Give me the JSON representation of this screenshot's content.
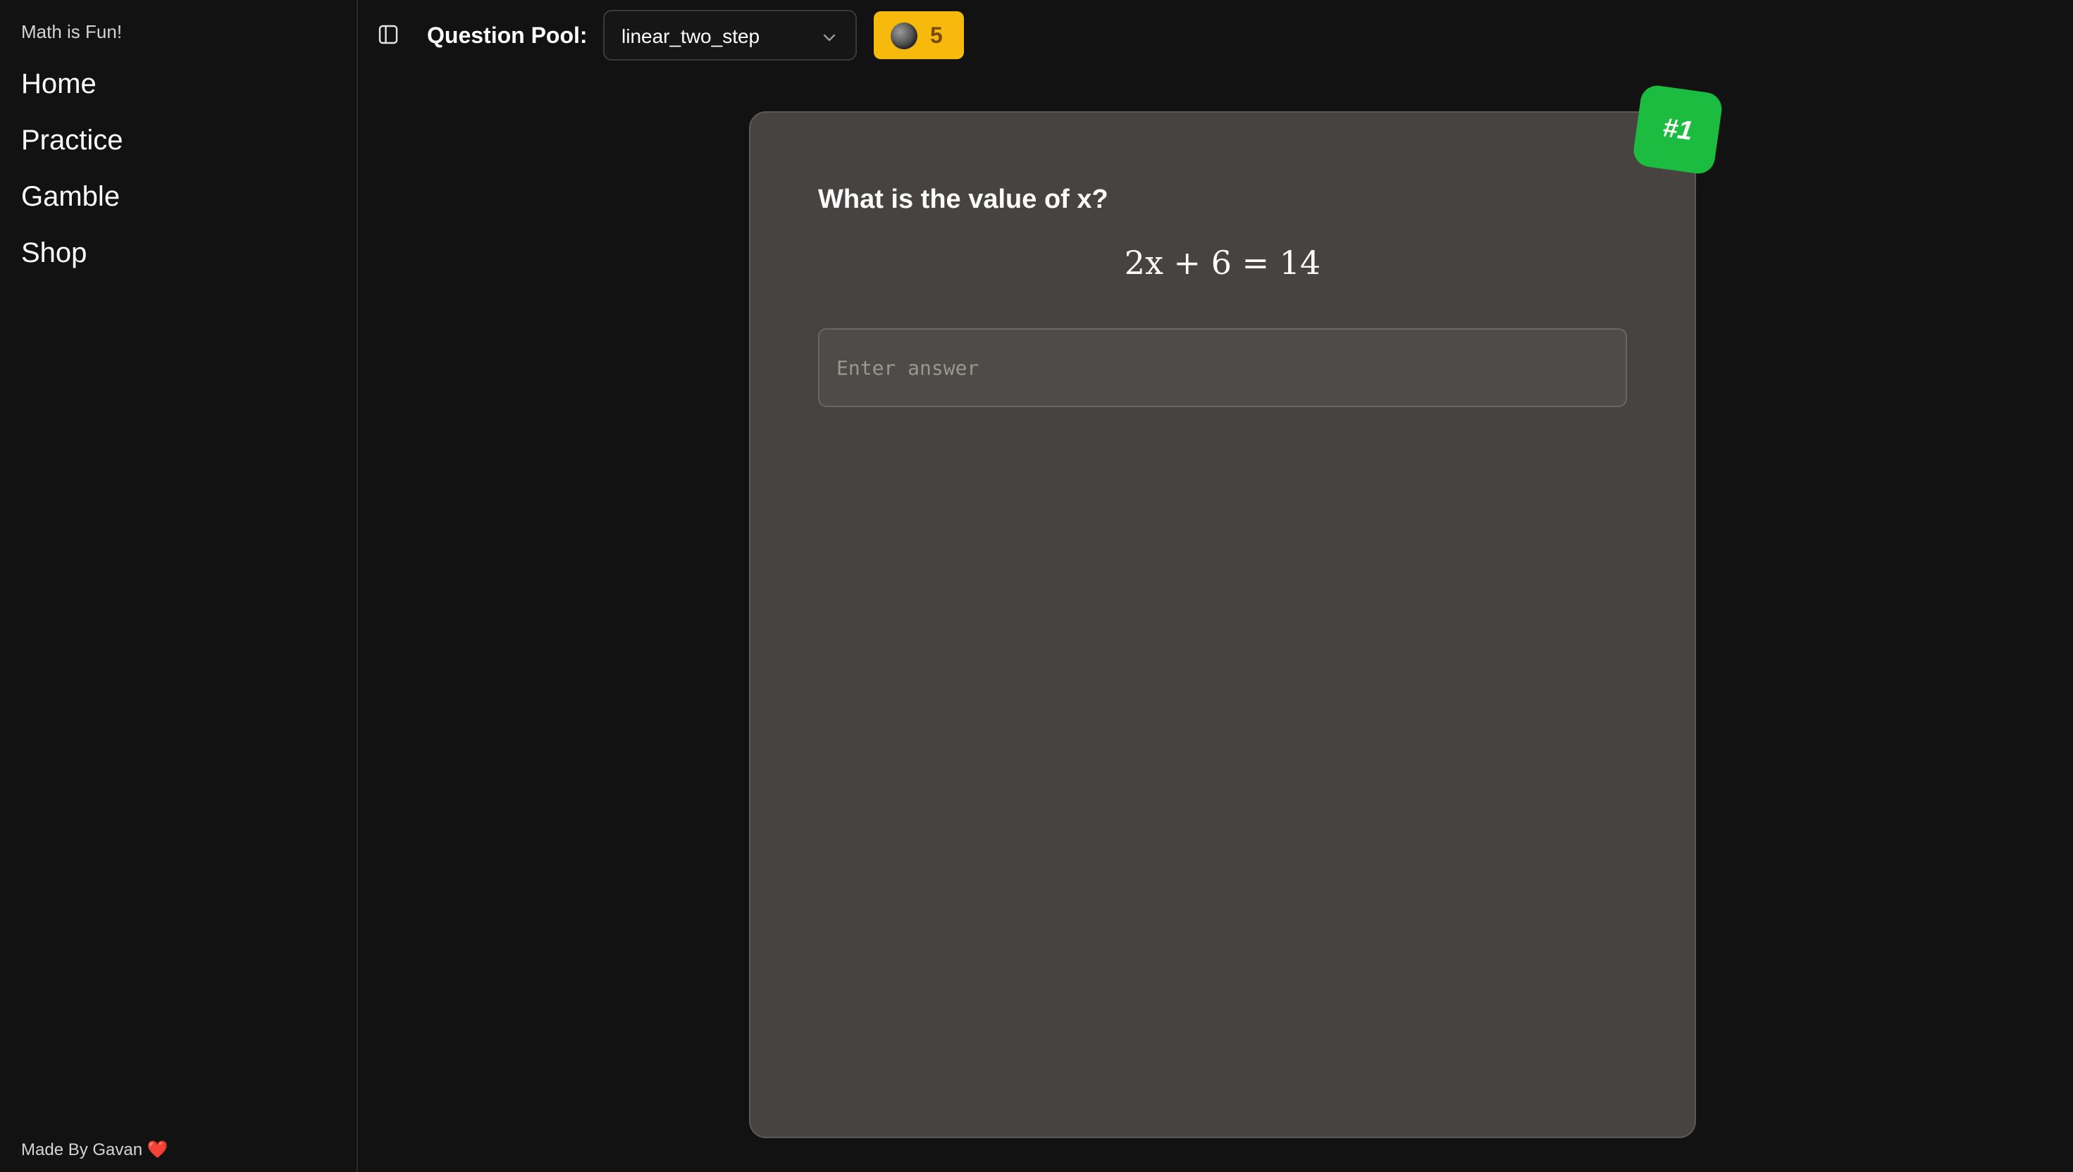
{
  "sidebar": {
    "brand": "Math is Fun!",
    "items": [
      {
        "label": "Home"
      },
      {
        "label": "Practice"
      },
      {
        "label": "Gamble"
      },
      {
        "label": "Shop"
      }
    ],
    "footer_text": "Made By Gavan",
    "footer_heart": "❤️"
  },
  "header": {
    "pool_label": "Question Pool:",
    "pool_value": "linear_two_step",
    "coins": "5",
    "sidebar_toggle_icon": "panel-left-icon",
    "coin_icon": "coin-icon"
  },
  "question": {
    "number": "#1",
    "title": "What is the value of x?",
    "equation": "2x + 6 = 14",
    "answer_placeholder": "Enter answer",
    "answer_value": ""
  },
  "colors": {
    "background": "#121212",
    "card": "#464340",
    "coin_badge": "#f7b90c",
    "number_badge": "#1bbc3f"
  }
}
